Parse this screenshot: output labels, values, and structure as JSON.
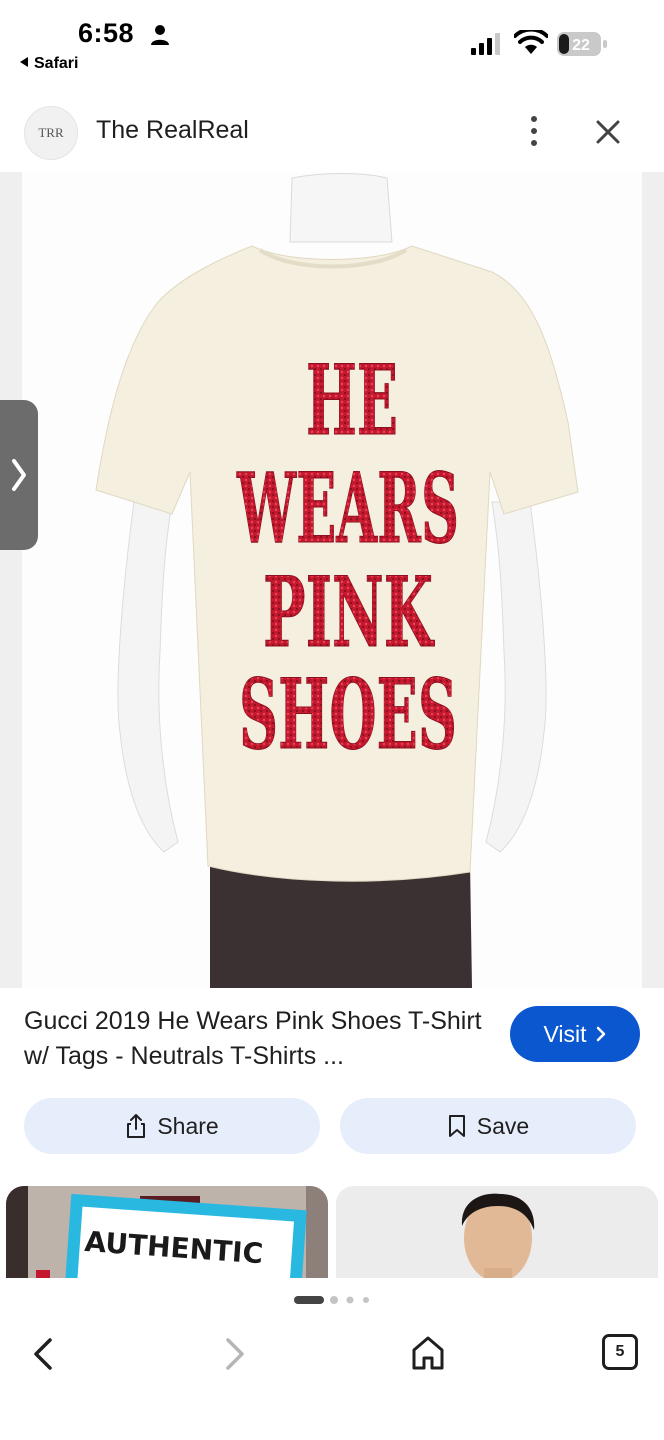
{
  "status_bar": {
    "time": "6:58",
    "back_app": "Safari",
    "battery": "22"
  },
  "header": {
    "site_logo": "TRR",
    "site_name": "The RealReal"
  },
  "product": {
    "shirt_text": [
      "HE",
      "WEARS",
      "PINK",
      "SHOES"
    ],
    "caption": "Gucci 2019 He Wears Pink Shoes T-Shirt w/ Tags - Neutrals T-Shirts ...",
    "visit_label": "Visit"
  },
  "actions": {
    "share_label": "Share",
    "save_label": "Save"
  },
  "related": {
    "left_thumb_text": "AUTHENTIC"
  },
  "bottom_nav": {
    "tab_count": "5"
  },
  "colors": {
    "accent": "#0b57d0",
    "chip_background": "#e7eefb",
    "shirt": "#f4efde",
    "sequin": "#c4182e"
  }
}
